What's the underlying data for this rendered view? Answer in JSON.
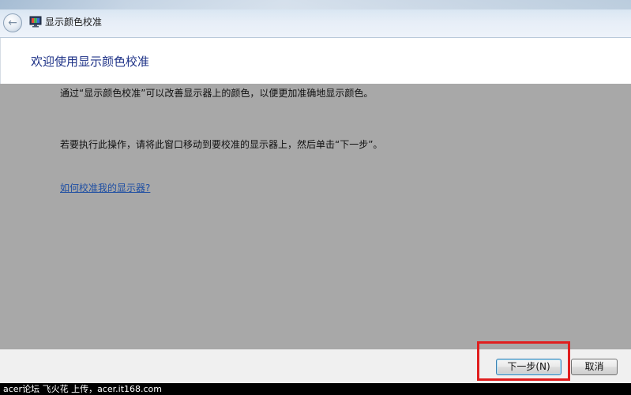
{
  "window": {
    "title": "显示颜色校准",
    "back_icon": "back-arrow-icon",
    "app_icon": "monitor-icon"
  },
  "header": {
    "heading": "欢迎使用显示颜色校准"
  },
  "main": {
    "paragraph_1": "通过“显示颜色校准”可以改善显示器上的颜色，以便更加准确地显示颜色。",
    "paragraph_2": "若要执行此操作，请将此窗口移动到要校准的显示器上，然后单击“下一步”。",
    "help_link": "如何校准我的显示器?"
  },
  "footer": {
    "next_label": "下一步(N)",
    "cancel_label": "取消"
  },
  "watermark": "acer论坛 飞火花 上传，acer.it168.com",
  "colors": {
    "heading": "#1e3287",
    "link": "#1f4fa3",
    "content_bg": "#a8a8a8",
    "highlight": "#e01e1e"
  }
}
